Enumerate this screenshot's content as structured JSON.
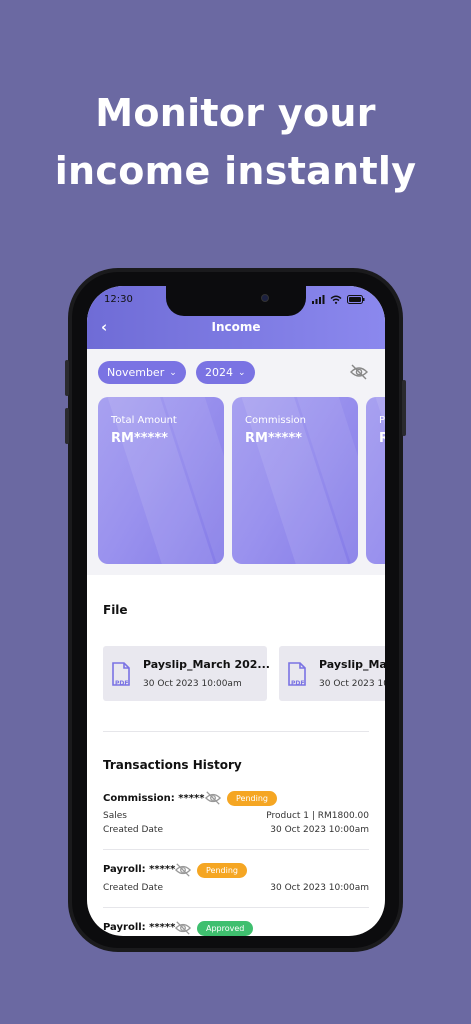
{
  "headline": {
    "line1": "Monitor your",
    "line2": "income instantly"
  },
  "status_bar": {
    "time": "12:30"
  },
  "header": {
    "title": "Income"
  },
  "filters": {
    "month": "November",
    "year": "2024"
  },
  "cards": [
    {
      "label": "Total Amount",
      "value": "RM*****"
    },
    {
      "label": "Commission",
      "value": "RM*****"
    },
    {
      "label": "P",
      "value": "R"
    }
  ],
  "file_section": {
    "title": "File",
    "files": [
      {
        "name": "Payslip_March 202...",
        "date": "30 Oct 2023  10:00am",
        "icon_text": "PDF"
      },
      {
        "name": "Payslip_Ma",
        "date": "30 Oct 2023  10:",
        "icon_text": "PDF"
      }
    ]
  },
  "transactions": {
    "title": "Transactions History",
    "items": [
      {
        "title": "Commission: *****",
        "status": "Pending",
        "left1": "Sales",
        "right1": "Product 1 | RM1800.00",
        "left2": "Created Date",
        "right2": "30 Oct 2023  10:00am"
      },
      {
        "title": "Payroll: *****",
        "status": "Pending",
        "left2": "Created Date",
        "right2": "30 Oct 2023  10:00am"
      },
      {
        "title": "Payroll: *****",
        "status": "Approved"
      }
    ]
  },
  "colors": {
    "background": "#6b69a2",
    "accent": "#7a73e3",
    "pending": "#f5a623",
    "approved": "#3fbf6f"
  }
}
